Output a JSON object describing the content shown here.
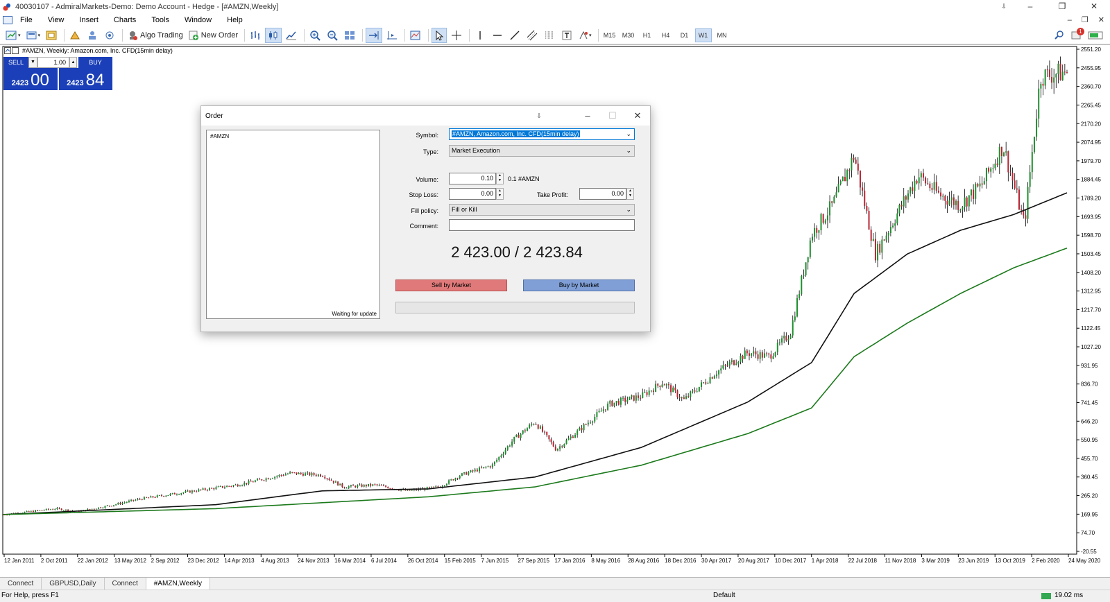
{
  "window": {
    "title": "40030107 - AdmiralMarkets-Demo: Demo Account - Hedge - [#AMZN,Weekly]",
    "minimize": "–",
    "restore": "❐",
    "close": "✕"
  },
  "menu": [
    "File",
    "View",
    "Insert",
    "Charts",
    "Tools",
    "Window",
    "Help"
  ],
  "mdi": {
    "minimize": "–",
    "restore": "❐",
    "close": "✕"
  },
  "toolbar": {
    "algo_trading": "Algo Trading",
    "new_order": "New Order",
    "timeframes": [
      "M15",
      "M30",
      "H1",
      "H4",
      "D1",
      "W1",
      "MN"
    ],
    "active_timeframe": "W1",
    "notifications_count": "1"
  },
  "chart": {
    "label": "#AMZN, Weekly:  Amazon.com, Inc. CFD(15min delay)",
    "one_click": {
      "sell_label": "SELL",
      "buy_label": "BUY",
      "volume": "1.00",
      "sell_price_small": "2423",
      "sell_price_big": "00",
      "buy_price_small": "2423",
      "buy_price_big": "84"
    }
  },
  "chart_data": {
    "type": "candlestick",
    "title": "#AMZN, Weekly",
    "y_ticks": [
      "2551.20",
      "2455.95",
      "2360.70",
      "2265.45",
      "2170.20",
      "2074.95",
      "1979.70",
      "1884.45",
      "1789.20",
      "1693.95",
      "1598.70",
      "1503.45",
      "1408.20",
      "1312.95",
      "1217.70",
      "1122.45",
      "1027.20",
      "931.95",
      "836.70",
      "741.45",
      "646.20",
      "550.95",
      "455.70",
      "360.45",
      "265.20",
      "169.95",
      "74.70",
      "-20.55"
    ],
    "x_ticks": [
      "12 Jan 2011",
      "2 Oct 2011",
      "22 Jan 2012",
      "13 May 2012",
      "2 Sep 2012",
      "23 Dec 2012",
      "14 Apr 2013",
      "4 Aug 2013",
      "24 Nov 2013",
      "16 Mar 2014",
      "6 Jul 2014",
      "26 Oct 2014",
      "15 Feb 2015",
      "7 Jun 2015",
      "27 Sep 2015",
      "17 Jan 2016",
      "8 May 2016",
      "28 Aug 2016",
      "18 Dec 2016",
      "30 Apr 2017",
      "20 Aug 2017",
      "10 Dec 2017",
      "1 Apr 2018",
      "22 Jul 2018",
      "11 Nov 2018",
      "3 Mar 2019",
      "23 Jun 2019",
      "13 Oct 2019",
      "2 Feb 2020",
      "24 May 2020"
    ],
    "ylim": [
      -20.55,
      2551.2
    ],
    "price_path": [
      [
        0,
        180
      ],
      [
        0.05,
        210
      ],
      [
        0.07,
        195
      ],
      [
        0.1,
        225
      ],
      [
        0.13,
        260
      ],
      [
        0.18,
        300
      ],
      [
        0.22,
        330
      ],
      [
        0.27,
        390
      ],
      [
        0.3,
        380
      ],
      [
        0.32,
        320
      ],
      [
        0.35,
        330
      ],
      [
        0.38,
        300
      ],
      [
        0.41,
        320
      ],
      [
        0.43,
        380
      ],
      [
        0.46,
        430
      ],
      [
        0.48,
        560
      ],
      [
        0.5,
        650
      ],
      [
        0.52,
        510
      ],
      [
        0.54,
        600
      ],
      [
        0.57,
        740
      ],
      [
        0.6,
        780
      ],
      [
        0.62,
        850
      ],
      [
        0.64,
        760
      ],
      [
        0.67,
        900
      ],
      [
        0.7,
        1000
      ],
      [
        0.72,
        980
      ],
      [
        0.74,
        1100
      ],
      [
        0.76,
        1600
      ],
      [
        0.78,
        1750
      ],
      [
        0.8,
        2000
      ],
      [
        0.82,
        1500
      ],
      [
        0.84,
        1700
      ],
      [
        0.86,
        1900
      ],
      [
        0.88,
        1800
      ],
      [
        0.9,
        1750
      ],
      [
        0.92,
        1850
      ],
      [
        0.94,
        2050
      ],
      [
        0.96,
        1650
      ],
      [
        0.975,
        2400
      ],
      [
        1,
        2423
      ]
    ],
    "sma_black": [
      [
        0,
        180
      ],
      [
        0.2,
        230
      ],
      [
        0.3,
        300
      ],
      [
        0.4,
        310
      ],
      [
        0.5,
        370
      ],
      [
        0.6,
        520
      ],
      [
        0.7,
        750
      ],
      [
        0.76,
        950
      ],
      [
        0.8,
        1300
      ],
      [
        0.85,
        1500
      ],
      [
        0.9,
        1620
      ],
      [
        0.95,
        1700
      ],
      [
        1,
        1810
      ]
    ],
    "sma_green": [
      [
        0,
        180
      ],
      [
        0.2,
        210
      ],
      [
        0.3,
        240
      ],
      [
        0.4,
        270
      ],
      [
        0.5,
        320
      ],
      [
        0.6,
        430
      ],
      [
        0.7,
        590
      ],
      [
        0.76,
        720
      ],
      [
        0.8,
        980
      ],
      [
        0.85,
        1150
      ],
      [
        0.9,
        1300
      ],
      [
        0.95,
        1430
      ],
      [
        1,
        1530
      ]
    ],
    "colors": {
      "up": "#1e8f2e",
      "down": "#b82432",
      "sma_black": "#111111",
      "sma_green": "#1c7a1c"
    }
  },
  "order": {
    "title": "Order",
    "tick_symbol": "#AMZN",
    "waiting": "Waiting for update",
    "symbol_label": "Symbol:",
    "symbol_value": "#AMZN, Amazon.com, Inc. CFD(15min delay)",
    "type_label": "Type:",
    "type_value": "Market Execution",
    "volume_label": "Volume:",
    "volume_value": "0.10",
    "volume_hint": "0.1 #AMZN",
    "sl_label": "Stop Loss:",
    "sl_value": "0.00",
    "tp_label": "Take Profit:",
    "tp_value": "0.00",
    "fill_label": "Fill policy:",
    "fill_value": "Fill or Kill",
    "comment_label": "Comment:",
    "comment_value": "",
    "price": "2 423.00 / 2 423.84",
    "sell_btn": "Sell by Market",
    "buy_btn": "Buy by Market"
  },
  "tabs": [
    "Connect",
    "GBPUSD,Daily",
    "Connect",
    "#AMZN,Weekly"
  ],
  "status": {
    "help": "For Help, press F1",
    "profile": "Default",
    "ping": "19.02 ms"
  }
}
